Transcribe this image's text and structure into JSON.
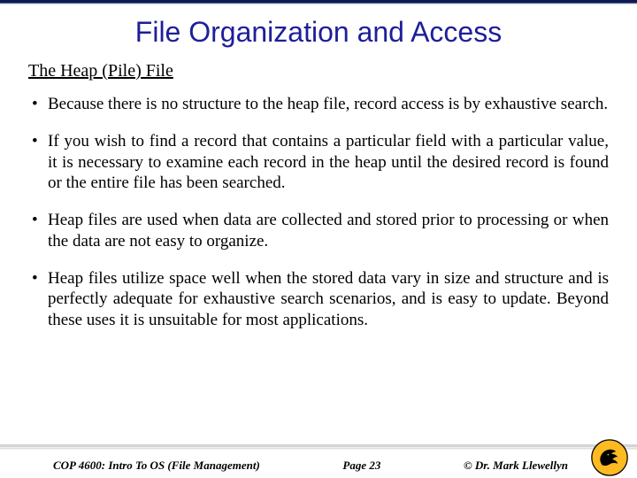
{
  "title": "File Organization and Access",
  "subtitle": "The Heap (Pile) File",
  "bullets": [
    "Because there is no structure to the heap file, record access is by exhaustive search.",
    "If you wish to find a record that contains a particular field with a particular value, it is necessary to examine each record in the heap until the desired record is found or the entire file has been searched.",
    "Heap files are used when data are collected and stored prior to processing or when the data are not easy to organize.",
    "Heap files utilize space well when the stored data vary in size and structure and is perfectly adequate for exhaustive search scenarios, and is easy to update.  Beyond these uses it is unsuitable for most applications."
  ],
  "footer": {
    "course": "COP 4600: Intro To OS  (File Management)",
    "page": "Page  23",
    "author": "© Dr. Mark Llewellyn"
  }
}
